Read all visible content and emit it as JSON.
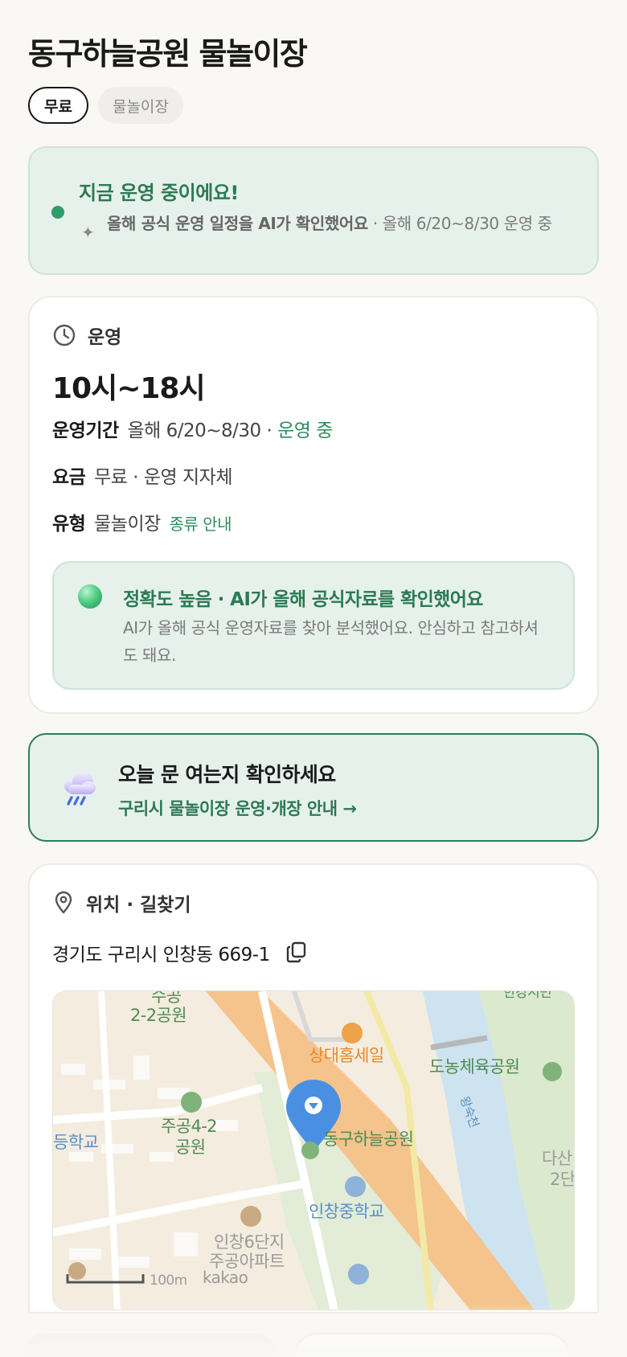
{
  "title": "동구하늘공원 물놀이장",
  "chips": [
    "무료",
    "물놀이장"
  ],
  "status": {
    "title": "지금 운영 중이에요!",
    "ai_note": "올해 공식 운영 일정을 AI가 확인했어요",
    "period_note": " · 올해 6/20~8/30 운영 중"
  },
  "hours_card": {
    "section_label": "운영",
    "hours": "10시~18시",
    "period_key": "운영기간",
    "period_value": "올해 6/20~8/30 · ",
    "period_status": "운영 중",
    "fee_key": "요금",
    "fee_value": "무료 · 운영 지자체",
    "type_key": "유형",
    "type_value": "물놀이장",
    "type_link": "종류 안내",
    "accuracy_title": "정확도 높음 · AI가 올해 공식자료를 확인했어요",
    "accuracy_text": "AI가 올해 공식 운영자료를 찾아 분석했어요. 안심하고 참고하셔도 돼요."
  },
  "check_card": {
    "title": "오늘 문 여는지 확인하세요",
    "link": "구리시 물놀이장 운영·개장 안내 →"
  },
  "location": {
    "section_label": "위치 · 길찾기",
    "address": "경기도 구리시 인창동 669-1",
    "map_labels": {
      "l1": "수공",
      "l2": "2-2공원",
      "l3": "상대홈세일",
      "l4": "도농체육공원",
      "l5": "주공4-2",
      "l6": "공원",
      "l7": "동구하늘공원",
      "l8": "등학교",
      "l9": "인창중학교",
      "l10": "다산",
      "l11": "2단",
      "l12": "인창6단지",
      "l13": "주공아파트",
      "l14": "100m",
      "l15": "kakao",
      "l16": "왕숙천",
      "l17": "한강시민"
    }
  },
  "colors": {
    "accent_green": "#2b7a54",
    "status_bg": "#e7f1ec",
    "page_bg": "#f9f8f4"
  }
}
